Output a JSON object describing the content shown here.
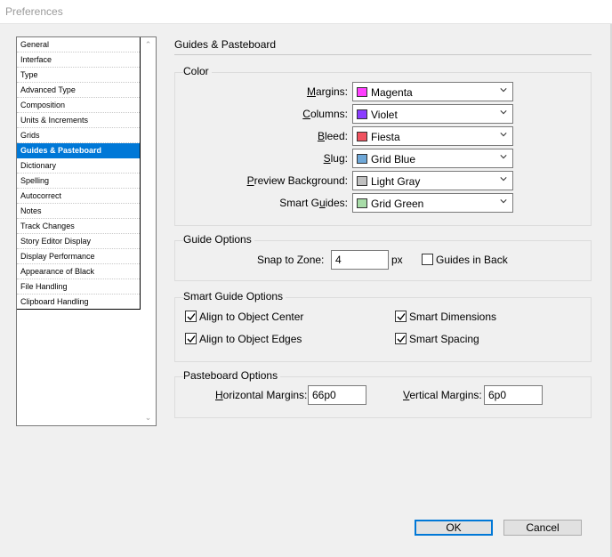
{
  "window": {
    "title": "Preferences"
  },
  "sidebar": {
    "items": [
      {
        "label": "General"
      },
      {
        "label": "Interface"
      },
      {
        "label": "Type"
      },
      {
        "label": "Advanced Type"
      },
      {
        "label": "Composition"
      },
      {
        "label": "Units & Increments"
      },
      {
        "label": "Grids"
      },
      {
        "label": "Guides & Pasteboard",
        "selected": true
      },
      {
        "label": "Dictionary"
      },
      {
        "label": "Spelling"
      },
      {
        "label": "Autocorrect"
      },
      {
        "label": "Notes"
      },
      {
        "label": "Track Changes"
      },
      {
        "label": "Story Editor Display"
      },
      {
        "label": "Display Performance"
      },
      {
        "label": "Appearance of Black"
      },
      {
        "label": "File Handling"
      },
      {
        "label": "Clipboard Handling"
      }
    ]
  },
  "main": {
    "title": "Guides & Pasteboard",
    "color": {
      "legend": "Color",
      "rows": [
        {
          "label": "Margins:",
          "value": "Magenta",
          "swatch": "#ff40ff"
        },
        {
          "label": "Columns:",
          "value": "Violet",
          "swatch": "#8a3cff"
        },
        {
          "label": "Bleed:",
          "value": "Fiesta",
          "swatch": "#f0525f"
        },
        {
          "label": "Slug:",
          "value": "Grid Blue",
          "swatch": "#6fa8d8"
        },
        {
          "label": "Preview Background:",
          "value": "Light Gray",
          "swatch": "#c0c0c0"
        },
        {
          "label": "Smart Guides:",
          "value": "Grid Green",
          "swatch": "#a8dca8"
        }
      ]
    },
    "guide_options": {
      "legend": "Guide Options",
      "snap_label": "Snap to Zone:",
      "snap_value": "4",
      "snap_unit": "px",
      "guides_in_back_label": "Guides in Back",
      "guides_in_back_checked": false
    },
    "smart_guide_options": {
      "legend": "Smart Guide Options",
      "align_center_label": "Align to Object Center",
      "align_edges_label": "Align to Object Edges",
      "smart_dimensions_label": "Smart Dimensions",
      "smart_spacing_label": "Smart Spacing"
    },
    "pasteboard_options": {
      "legend": "Pasteboard Options",
      "horizontal_label": "Horizontal Margins:",
      "horizontal_value": "66p0",
      "vertical_label": "Vertical Margins:",
      "vertical_value": "6p0"
    }
  },
  "buttons": {
    "ok": "OK",
    "cancel": "Cancel"
  }
}
